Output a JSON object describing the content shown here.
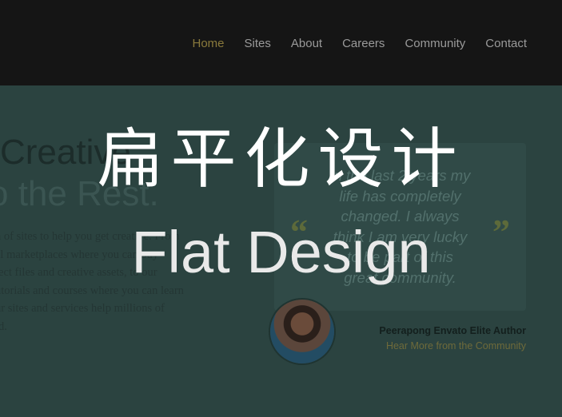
{
  "nav": {
    "items": [
      {
        "label": "Home",
        "active": true
      },
      {
        "label": "Sites"
      },
      {
        "label": "About"
      },
      {
        "label": "Careers"
      },
      {
        "label": "Community"
      },
      {
        "label": "Contact"
      }
    ]
  },
  "hero": {
    "headline_line1": "Creative",
    "headline_line2": "o the Rest.",
    "body_lines": [
      "n of sites to help you get creative. From",
      "al marketplaces where you can buy",
      "ject files and creative assets, to our",
      "utorials and courses where you can learn",
      "ur sites and services help millions of",
      "ld."
    ]
  },
  "testimonial": {
    "quote_lines": [
      "In the last 2 years my",
      "life has completely",
      "changed. I always",
      "think I am very lucky",
      "to be part of this",
      "great community."
    ],
    "open_quote": "“",
    "close_quote": "”",
    "author": "Peerapong Envato Elite Author",
    "link": "Hear More from the Community"
  },
  "overlay": {
    "title_cn": "扁平化设计",
    "title_en": "Flat Design"
  },
  "colors": {
    "header_bg": "#151515",
    "content_bg": "#2b4340",
    "nav_active": "#8a7a3c",
    "nav_inactive": "#9a9a9a"
  }
}
